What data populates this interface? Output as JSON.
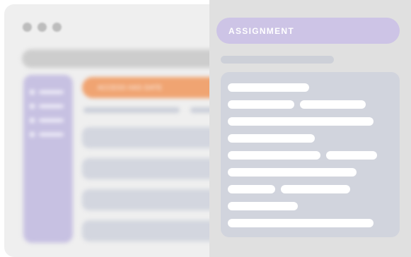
{
  "window": {
    "controls": [
      "dot",
      "dot",
      "dot"
    ]
  },
  "background_page": {
    "banner_text": "ACCESS HAS DATE",
    "sidebar_item_count": 4,
    "list_row_count": 4
  },
  "assignment_panel": {
    "title": "ASSIGNMENT"
  },
  "colors": {
    "accent_purple": "#cdc4e6",
    "banner_orange": "#f0a472",
    "card_gray": "#d1d4dd"
  }
}
